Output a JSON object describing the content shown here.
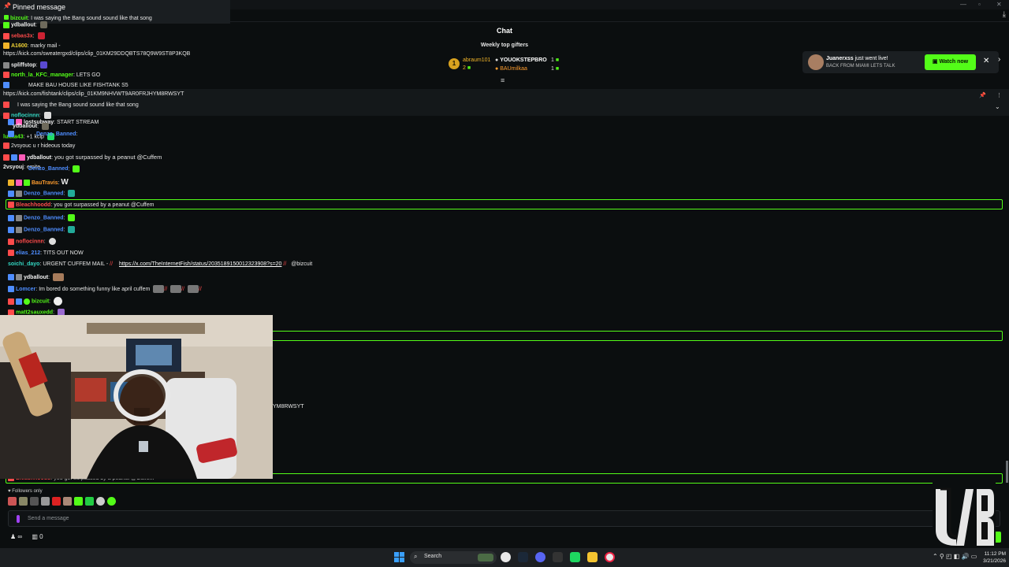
{
  "window": {
    "title": ""
  },
  "pinned": {
    "title": "Pinned message",
    "user": "bizcuit",
    "text": "I was saying the Bang sound sound like that song"
  },
  "chat": {
    "title": "Chat",
    "gifters_title": "Weekly top gifters",
    "gifters": [
      {
        "rank": "1",
        "name": "abraum101",
        "count": "2"
      },
      {
        "rank": "",
        "name": "YOUOKSTEPBRO",
        "count": "1"
      },
      {
        "rank": "",
        "name": "BAUmilkaa",
        "count": "1"
      }
    ],
    "overlay_lines": [
      {
        "user": "bizcuit",
        "text": "I was saying the Bang sound sound like that song"
      },
      {
        "user": "ydballout",
        "text": ""
      },
      {
        "user": "sebas3x",
        "text": ""
      },
      {
        "user": "A1600",
        "text": "marky mail -"
      },
      {
        "user": "",
        "text": "https://kick.com/sweatergxd/clips/clip_01KM29DDQBTS78Q9W9ST8P3KQB"
      },
      {
        "user": "spliffstop",
        "text": ""
      },
      {
        "user": "north_la_KFC_manager",
        "text": "LETS GO"
      },
      {
        "user": "",
        "text": "MAKE BAU HOUSE LIKE FISHTANK S5"
      },
      {
        "user": "",
        "text": "https://kick.com/fishtank/clips/clip_01KM9NHVWT9AR0FRJHYM8RWSYT"
      },
      {
        "user": "",
        "text": "I was saying the Bang sound sound like that song"
      },
      {
        "user": "noflocinnn",
        "text": ""
      },
      {
        "user": "lostsubway",
        "text": "START STREAM"
      },
      {
        "user": "ydballout",
        "text": ""
      },
      {
        "user": "lukka43",
        "text": "+1 kclp"
      },
      {
        "user": "Denzo_Banned",
        "text": ""
      },
      {
        "user": "",
        "text": "2vsyouc u r hideous today"
      },
      {
        "user": "ydballout",
        "text": "you got surpassed by a peanut @Cuffem"
      },
      {
        "user": "2vsyouj",
        "text": "emite"
      },
      {
        "user": "Denzo_Banned",
        "text": ""
      }
    ],
    "messages": [
      {
        "user": "BauTravis",
        "text": "W"
      },
      {
        "user": "Denzo_Banned",
        "text": ""
      },
      {
        "user": "Bleachhoodd",
        "text": "you got surpassed by a peanut @Cuffem"
      },
      {
        "user": "Denzo_Banned",
        "text": ""
      },
      {
        "user": "Denzo_Banned",
        "text": ""
      },
      {
        "user": "noflocinnn",
        "text": ""
      },
      {
        "user": "elias_212",
        "text": "TITS OUT NOW"
      },
      {
        "user": "soichi_dayo",
        "text": "URGENT CUFFEM MAIL -",
        "link": "https://x.com/TheInternetFish/status/2035189150012323908?s=20",
        "tail": "@bizcuit"
      },
      {
        "user": "ydballout",
        "text": ""
      },
      {
        "user": "Lomcer",
        "text": "Im bored do something funny like april cuffem"
      },
      {
        "user": "bizcuit",
        "text": ""
      },
      {
        "user": "matt2sauxedd",
        "text": ""
      }
    ],
    "partial_link_tail": "YM8RWSYT",
    "bottom_highlight": {
      "user": "Bleachhoodd",
      "text": "you got surpassed by a peanut @Cuffem"
    },
    "followers_only": "Followers only",
    "input_placeholder": "Send a message",
    "infinity_label": "∞",
    "gift_count": "0"
  },
  "notification": {
    "name": "Juanerxss",
    "action": "just went live!",
    "subtitle": "BACK FROM MIAMI LETS TALK",
    "button": "Watch now"
  },
  "taskbar": {
    "search_label": "Search",
    "time": "11:12 PM",
    "date": "3/21/2026"
  },
  "colors": {
    "accent": "#53fc18",
    "background": "#0b0e0f"
  }
}
